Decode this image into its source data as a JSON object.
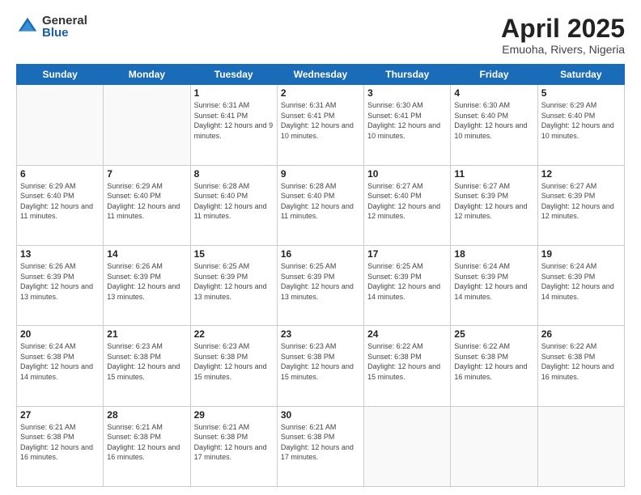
{
  "header": {
    "logo_general": "General",
    "logo_blue": "Blue",
    "month_title": "April 2025",
    "subtitle": "Emuoha, Rivers, Nigeria"
  },
  "days_of_week": [
    "Sunday",
    "Monday",
    "Tuesday",
    "Wednesday",
    "Thursday",
    "Friday",
    "Saturday"
  ],
  "weeks": [
    [
      {
        "day": "",
        "info": ""
      },
      {
        "day": "",
        "info": ""
      },
      {
        "day": "1",
        "info": "Sunrise: 6:31 AM\nSunset: 6:41 PM\nDaylight: 12 hours and 9 minutes."
      },
      {
        "day": "2",
        "info": "Sunrise: 6:31 AM\nSunset: 6:41 PM\nDaylight: 12 hours and 10 minutes."
      },
      {
        "day": "3",
        "info": "Sunrise: 6:30 AM\nSunset: 6:41 PM\nDaylight: 12 hours and 10 minutes."
      },
      {
        "day": "4",
        "info": "Sunrise: 6:30 AM\nSunset: 6:40 PM\nDaylight: 12 hours and 10 minutes."
      },
      {
        "day": "5",
        "info": "Sunrise: 6:29 AM\nSunset: 6:40 PM\nDaylight: 12 hours and 10 minutes."
      }
    ],
    [
      {
        "day": "6",
        "info": "Sunrise: 6:29 AM\nSunset: 6:40 PM\nDaylight: 12 hours and 11 minutes."
      },
      {
        "day": "7",
        "info": "Sunrise: 6:29 AM\nSunset: 6:40 PM\nDaylight: 12 hours and 11 minutes."
      },
      {
        "day": "8",
        "info": "Sunrise: 6:28 AM\nSunset: 6:40 PM\nDaylight: 12 hours and 11 minutes."
      },
      {
        "day": "9",
        "info": "Sunrise: 6:28 AM\nSunset: 6:40 PM\nDaylight: 12 hours and 11 minutes."
      },
      {
        "day": "10",
        "info": "Sunrise: 6:27 AM\nSunset: 6:40 PM\nDaylight: 12 hours and 12 minutes."
      },
      {
        "day": "11",
        "info": "Sunrise: 6:27 AM\nSunset: 6:39 PM\nDaylight: 12 hours and 12 minutes."
      },
      {
        "day": "12",
        "info": "Sunrise: 6:27 AM\nSunset: 6:39 PM\nDaylight: 12 hours and 12 minutes."
      }
    ],
    [
      {
        "day": "13",
        "info": "Sunrise: 6:26 AM\nSunset: 6:39 PM\nDaylight: 12 hours and 13 minutes."
      },
      {
        "day": "14",
        "info": "Sunrise: 6:26 AM\nSunset: 6:39 PM\nDaylight: 12 hours and 13 minutes."
      },
      {
        "day": "15",
        "info": "Sunrise: 6:25 AM\nSunset: 6:39 PM\nDaylight: 12 hours and 13 minutes."
      },
      {
        "day": "16",
        "info": "Sunrise: 6:25 AM\nSunset: 6:39 PM\nDaylight: 12 hours and 13 minutes."
      },
      {
        "day": "17",
        "info": "Sunrise: 6:25 AM\nSunset: 6:39 PM\nDaylight: 12 hours and 14 minutes."
      },
      {
        "day": "18",
        "info": "Sunrise: 6:24 AM\nSunset: 6:39 PM\nDaylight: 12 hours and 14 minutes."
      },
      {
        "day": "19",
        "info": "Sunrise: 6:24 AM\nSunset: 6:39 PM\nDaylight: 12 hours and 14 minutes."
      }
    ],
    [
      {
        "day": "20",
        "info": "Sunrise: 6:24 AM\nSunset: 6:38 PM\nDaylight: 12 hours and 14 minutes."
      },
      {
        "day": "21",
        "info": "Sunrise: 6:23 AM\nSunset: 6:38 PM\nDaylight: 12 hours and 15 minutes."
      },
      {
        "day": "22",
        "info": "Sunrise: 6:23 AM\nSunset: 6:38 PM\nDaylight: 12 hours and 15 minutes."
      },
      {
        "day": "23",
        "info": "Sunrise: 6:23 AM\nSunset: 6:38 PM\nDaylight: 12 hours and 15 minutes."
      },
      {
        "day": "24",
        "info": "Sunrise: 6:22 AM\nSunset: 6:38 PM\nDaylight: 12 hours and 15 minutes."
      },
      {
        "day": "25",
        "info": "Sunrise: 6:22 AM\nSunset: 6:38 PM\nDaylight: 12 hours and 16 minutes."
      },
      {
        "day": "26",
        "info": "Sunrise: 6:22 AM\nSunset: 6:38 PM\nDaylight: 12 hours and 16 minutes."
      }
    ],
    [
      {
        "day": "27",
        "info": "Sunrise: 6:21 AM\nSunset: 6:38 PM\nDaylight: 12 hours and 16 minutes."
      },
      {
        "day": "28",
        "info": "Sunrise: 6:21 AM\nSunset: 6:38 PM\nDaylight: 12 hours and 16 minutes."
      },
      {
        "day": "29",
        "info": "Sunrise: 6:21 AM\nSunset: 6:38 PM\nDaylight: 12 hours and 17 minutes."
      },
      {
        "day": "30",
        "info": "Sunrise: 6:21 AM\nSunset: 6:38 PM\nDaylight: 12 hours and 17 minutes."
      },
      {
        "day": "",
        "info": ""
      },
      {
        "day": "",
        "info": ""
      },
      {
        "day": "",
        "info": ""
      }
    ]
  ]
}
